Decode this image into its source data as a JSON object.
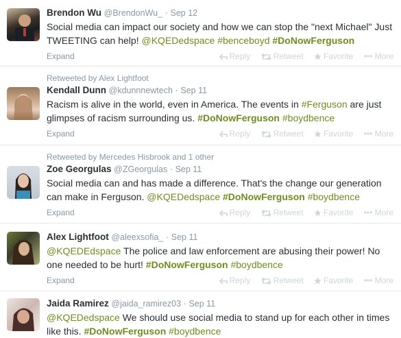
{
  "actions": {
    "reply": "Reply",
    "retweet": "Retweet",
    "favorite": "Favorite",
    "more": "More",
    "expand": "Expand"
  },
  "colors": {
    "link": "#6f8d1e",
    "muted": "#8899a6",
    "action": "#ccd6dd"
  },
  "tweets": [
    {
      "name": "Brendon Wu",
      "handle": "@BrendonWu_",
      "time": "Sep 12",
      "retweeted_by": "",
      "text_a": "Social media can impact our society and how we can stop the \"next Michael\" Just TWEETING can help! ",
      "mention1": "@KQEDedspace",
      "tag1": "#benceboyd",
      "tag2": "#DoNowFerguson"
    },
    {
      "name": "Kendall Dunn",
      "handle": "@kdunnnewtech",
      "time": "Sep 11",
      "retweeted_by": "Retweeted by Alex Lightfoot",
      "text_a": "Racism is alive in the world, even in America. The events in ",
      "tag0": "#Ferguson",
      "text_b": " are just glimpses of racism surrounding us. ",
      "tag1": "#DoNowFerguson",
      "tag2": "#boydbence"
    },
    {
      "name": "Zoe Georgulas",
      "handle": "@ZGeorgulas",
      "time": "Sep 11",
      "retweeted_by": "Retweeted by Mercedes Hisbrook and 1 other",
      "text_a": "Social media can and has made a difference. That's the change our generation can make in Ferguson. ",
      "mention1": "@KQEDedspace",
      "tag1": "#DoNowFerguson",
      "tag2": "#boydbence"
    },
    {
      "name": "Alex Lightfoot",
      "handle": "@aleexsofia_",
      "time": "Sep 11",
      "retweeted_by": "",
      "mention1": "@KQEDEdspace",
      "text_a": " The police and law enforcement are abusing their power! No one needed to be hurt! ",
      "tag1": "#DoNowFerguson",
      "tag2": "#boydbence"
    },
    {
      "name": "Jaida Ramirez",
      "handle": "@jaida_ramirez03",
      "time": "Sep 11",
      "retweeted_by": "",
      "mention1": "@KQEDedspace",
      "text_a": " We should use social media to stand up for each other in times like this. ",
      "tag1": "#DoNowFerguson",
      "tag2": "#boydbence"
    }
  ]
}
